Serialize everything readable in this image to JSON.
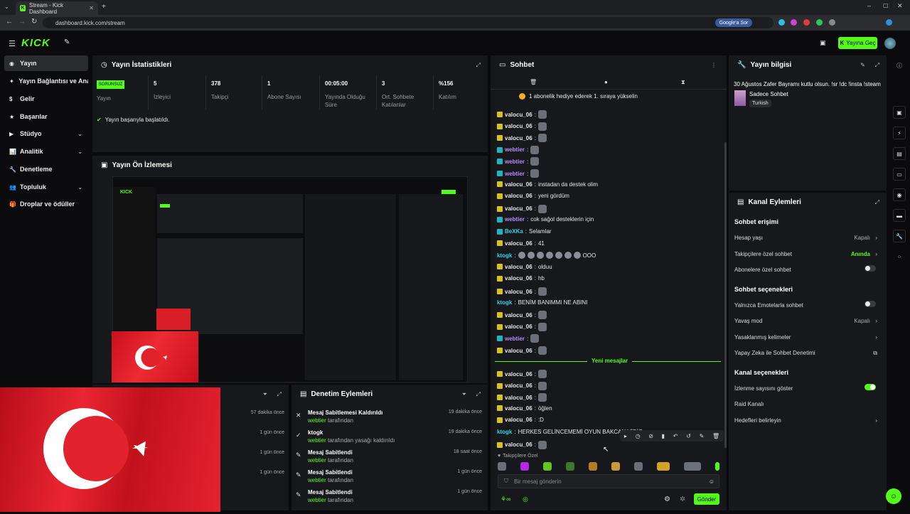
{
  "browser": {
    "tab_title": "Stream - Kick Dashboard",
    "url": "dashboard.kick.com/stream",
    "google_btn": "Google'a Sor"
  },
  "header": {
    "logo": "KICK",
    "golive": "Yayına Geç"
  },
  "sidebar": {
    "items": [
      {
        "label": "Yayın",
        "active": true,
        "chevron": false
      },
      {
        "label": "Yayın Bağlantısı ve Anahtarı",
        "active": false,
        "chevron": false
      },
      {
        "label": "Gelir",
        "active": false,
        "chevron": false
      },
      {
        "label": "Başarılar",
        "active": false,
        "chevron": false
      },
      {
        "label": "Stüdyo",
        "active": false,
        "chevron": true
      },
      {
        "label": "Analitik",
        "active": false,
        "chevron": true
      },
      {
        "label": "Denetleme",
        "active": false,
        "chevron": false
      },
      {
        "label": "Topluluk",
        "active": false,
        "chevron": true
      },
      {
        "label": "Droplar ve ödüller",
        "active": false,
        "chevron": false
      }
    ]
  },
  "stats": {
    "title": "Yayın İstatistikleri",
    "status_badge": "SORUNSUZ",
    "status_label": "Yayın",
    "items": [
      {
        "value": "5",
        "label": "İzleyici"
      },
      {
        "value": "378",
        "label": "Takipçi"
      },
      {
        "value": "1",
        "label": "Abone Sayısı"
      },
      {
        "value": "00:05:00",
        "label": "Yayında Olduğu Süre"
      },
      {
        "value": "3",
        "label": "Ort. Sohbete Katılanlar"
      },
      {
        "value": "%156",
        "label": "Katılım"
      }
    ],
    "success_msg": "Yayın başarıyla başlatıldı."
  },
  "preview": {
    "title": "Yayın Ön İzlemesi"
  },
  "lower_left": {
    "times": [
      "57 dakika önce",
      "1 gün önce",
      "1 gün önce",
      "1 gün önce"
    ]
  },
  "moderation": {
    "title": "Denetim Eylemleri",
    "rows": [
      {
        "icon": "unpin-icon",
        "glyph": "✕",
        "title": "Mesaj Sabitlemesi Kaldırıldı",
        "by": "webtier",
        "suffix": "tarafından",
        "ago": "19 dakika önce"
      },
      {
        "icon": "ban-icon",
        "glyph": "✓",
        "title": "ktogk",
        "by": "webtier",
        "suffix": "tarafından yasağı kaldırıldı",
        "ago": "19 dakika önce"
      },
      {
        "icon": "pin-icon",
        "glyph": "✎",
        "title": "Mesaj Sabitlendi",
        "by": "webtier",
        "suffix": "tarafından",
        "ago": "18 saat önce"
      },
      {
        "icon": "pin-icon",
        "glyph": "✎",
        "title": "Mesaj Sabitlendi",
        "by": "webtier",
        "suffix": "tarafından",
        "ago": "1 gün önce"
      },
      {
        "icon": "pin-icon",
        "glyph": "✎",
        "title": "Mesaj Sabitlendi",
        "by": "webtier",
        "suffix": "tarafından",
        "ago": "1 gün önce"
      }
    ]
  },
  "chat": {
    "title": "Sohbet",
    "pinned": "1 abonelik hediye ederek 1. sıraya yükselin",
    "messages": [
      {
        "badge": "y",
        "user": "valocu_06",
        "color": "#e6e6e6",
        "text": "",
        "emotes": 1
      },
      {
        "badge": "y",
        "user": "valocu_06",
        "color": "#e6e6e6",
        "text": "",
        "emotes": 1
      },
      {
        "badge": "y",
        "user": "valocu_06",
        "color": "#e6e6e6",
        "text": "",
        "emotes": 1
      },
      {
        "badge": "g",
        "user": "webtier",
        "color": "#b58cff",
        "text": "",
        "emotes": 1
      },
      {
        "badge": "g",
        "user": "webtier",
        "color": "#b58cff",
        "text": "",
        "emotes": 1
      },
      {
        "badge": "g",
        "user": "webtier",
        "color": "#b58cff",
        "text": "",
        "emotes": 1
      },
      {
        "badge": "y",
        "user": "valocu_06",
        "color": "#e6e6e6",
        "text": "instadan da destek olim",
        "emotes": 0
      },
      {
        "badge": "y",
        "user": "valocu_06",
        "color": "#e6e6e6",
        "text": "yeni gördüm",
        "emotes": 0
      },
      {
        "badge": "y",
        "user": "valocu_06",
        "color": "#e6e6e6",
        "text": "",
        "emotes": 1
      },
      {
        "badge": "g",
        "user": "webtier",
        "color": "#b58cff",
        "text": "cok sağol desteklerin için",
        "emotes": 0
      },
      {
        "badge": "g",
        "user": "BeXKa",
        "color": "#2ed3e8",
        "text": "Selamlar",
        "emotes": 0
      },
      {
        "badge": "y",
        "user": "valocu_06",
        "color": "#e6e6e6",
        "text": "41",
        "emotes": 0
      },
      {
        "badge": "",
        "user": "ktogk",
        "color": "#2ed3e8",
        "text": "OOO",
        "emotes": 7
      },
      {
        "badge": "y",
        "user": "valocu_06",
        "color": "#e6e6e6",
        "text": "olduu",
        "emotes": 0
      },
      {
        "badge": "y",
        "user": "valocu_06",
        "color": "#e6e6e6",
        "text": "hb",
        "emotes": 0
      },
      {
        "badge": "y",
        "user": "valocu_06",
        "color": "#e6e6e6",
        "text": "",
        "emotes": 1
      },
      {
        "badge": "",
        "user": "ktogk",
        "color": "#2ed3e8",
        "text": "BENİM BANIMMI NE ABINI",
        "emotes": 0
      },
      {
        "badge": "y",
        "user": "valocu_06",
        "color": "#e6e6e6",
        "text": "",
        "emotes": 1
      },
      {
        "badge": "y",
        "user": "valocu_06",
        "color": "#e6e6e6",
        "text": "",
        "emotes": 1
      },
      {
        "badge": "g",
        "user": "webtier",
        "color": "#b58cff",
        "text": "",
        "emotes": 1
      },
      {
        "badge": "y",
        "user": "valocu_06",
        "color": "#e6e6e6",
        "text": "",
        "emotes": 1
      }
    ],
    "new_messages": "Yeni mesajlar",
    "messages2": [
      {
        "badge": "y",
        "user": "valocu_06",
        "color": "#e6e6e6",
        "text": "",
        "emotes": 1
      },
      {
        "badge": "y",
        "user": "valocu_06",
        "color": "#e6e6e6",
        "text": "",
        "emotes": 1
      },
      {
        "badge": "y",
        "user": "valocu_06",
        "color": "#e6e6e6",
        "text": "",
        "emotes": 1
      },
      {
        "badge": "y",
        "user": "valocu_06",
        "color": "#e6e6e6",
        "text": "öğlen",
        "emotes": 0
      },
      {
        "badge": "y",
        "user": "valocu_06",
        "color": "#e6e6e6",
        "text": ":D",
        "emotes": 0
      },
      {
        "badge": "",
        "user": "ktogk",
        "color": "#2ed3e8",
        "text": "HERKES GELİNCEMEMİ OYUN BAKCAN VİDİC",
        "emotes": 0
      },
      {
        "badge": "y",
        "user": "valocu_06",
        "color": "#e6e6e6",
        "text": "",
        "emotes": 1
      }
    ],
    "followers_only": "Takipçilere Özel",
    "input_placeholder": "Bir mesaj gönderin",
    "send": "Gönder"
  },
  "stream_info": {
    "title": "Yayın bilgisi",
    "stream_title": "30 Ağustos Zafer Bayramı kutlu olsun. !sr !dc !insta !steam",
    "category": "Sadece Sohbet",
    "tag": "Turkish"
  },
  "channel": {
    "title": "Kanal Eylemleri",
    "sections": [
      {
        "heading": "Sohbet erişimi",
        "rows": [
          {
            "label": "Hesap yaşı",
            "value": "Kapalı",
            "ctl": "chev"
          },
          {
            "label": "Takipçilere özel sohbet",
            "value": "Anında",
            "ctl": "chev",
            "green": true
          },
          {
            "label": "Abonelere özel sohbet",
            "value": "",
            "ctl": "toggle",
            "on": false
          }
        ]
      },
      {
        "heading": "Sohbet seçenekleri",
        "rows": [
          {
            "label": "Yalnızca Emotelarla sohbet",
            "value": "",
            "ctl": "toggle",
            "on": false
          },
          {
            "label": "Yavaş mod",
            "value": "Kapalı",
            "ctl": "chev"
          },
          {
            "label": "Yasaklanmış kelimeler",
            "value": "",
            "ctl": "chev"
          },
          {
            "label": "Yapay Zeka ile Sohbet Denetimi",
            "value": "",
            "ctl": "ext"
          }
        ]
      },
      {
        "heading": "Kanal seçenekleri",
        "rows": [
          {
            "label": "İzlenme sayısını göster",
            "value": "",
            "ctl": "toggle",
            "on": true
          },
          {
            "label": "Raid Kanalı",
            "value": "",
            "ctl": "none"
          },
          {
            "label": "Hedefleri belirleyin",
            "value": "",
            "ctl": "chev"
          }
        ]
      }
    ]
  },
  "colors": {
    "accent": "#53fc18",
    "panel": "#17181b",
    "bg": "#0b0b0d"
  }
}
